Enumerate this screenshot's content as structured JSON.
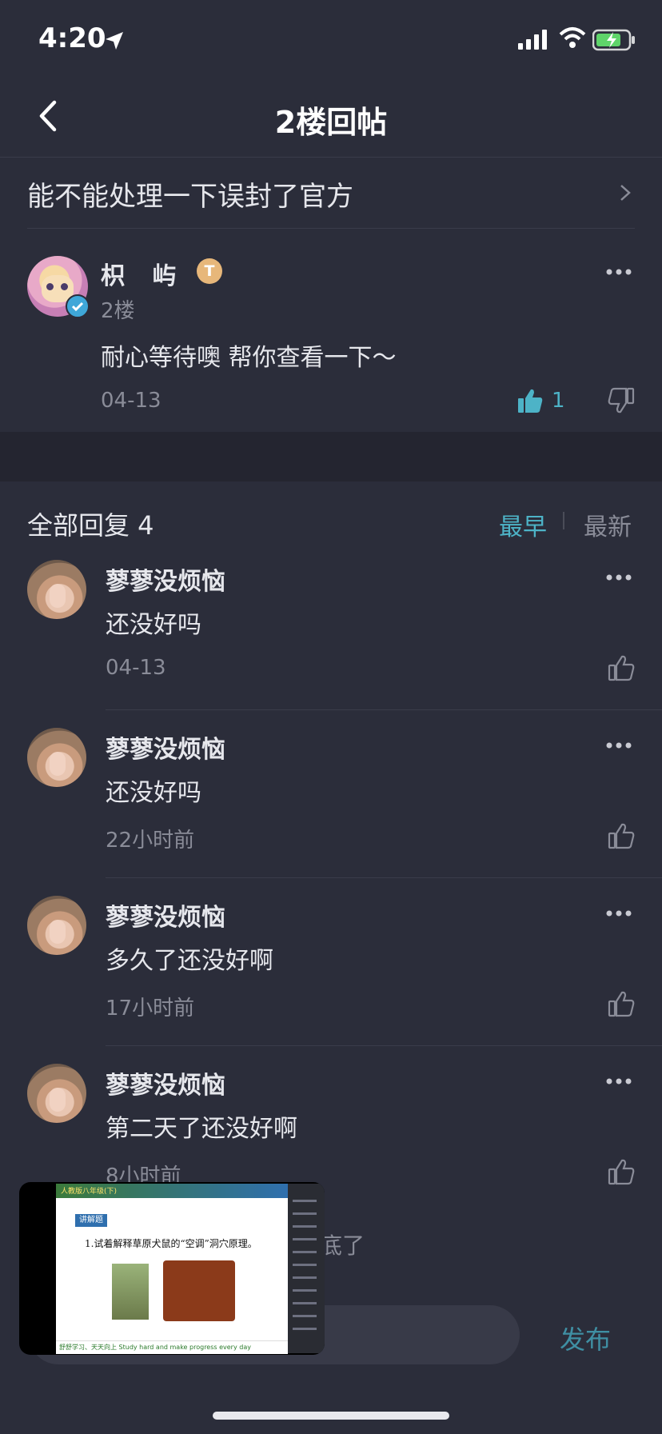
{
  "status": {
    "time": "4:20"
  },
  "nav": {
    "title": "2楼回帖"
  },
  "thread": {
    "title": "能不能处理一下误封了官方"
  },
  "post": {
    "author": "枳 屿",
    "level": "T",
    "floor": "2楼",
    "text": "耐心等待噢 帮你查看一下～",
    "date": "04-13",
    "likes": "1"
  },
  "replies_header": {
    "label": "全部回复 4",
    "sort_earliest": "最早",
    "sort_latest": "最新"
  },
  "replies": [
    {
      "author": "蓼蓼没烦恼",
      "text": "还没好吗",
      "time": "04-13"
    },
    {
      "author": "蓼蓼没烦恼",
      "text": "还没好吗",
      "time": "22小时前"
    },
    {
      "author": "蓼蓼没烦恼",
      "text": "多久了还没好啊",
      "time": "17小时前"
    },
    {
      "author": "蓼蓼没烦恼",
      "text": "第二天了还没好啊",
      "time": "8小时前"
    }
  ],
  "bottom": {
    "hint": "底了",
    "publish": "发布"
  },
  "pip": {
    "header": "人教版八年级(下)",
    "tag": "讲解题",
    "question": "1.试着解释草原犬鼠的“空调”洞穴原理。",
    "footer": "舒舒学习、天天向上  Study hard and make progress every day"
  },
  "colors": {
    "accent": "#4db3c7",
    "background": "#2b2d3a",
    "band": "#242530"
  }
}
